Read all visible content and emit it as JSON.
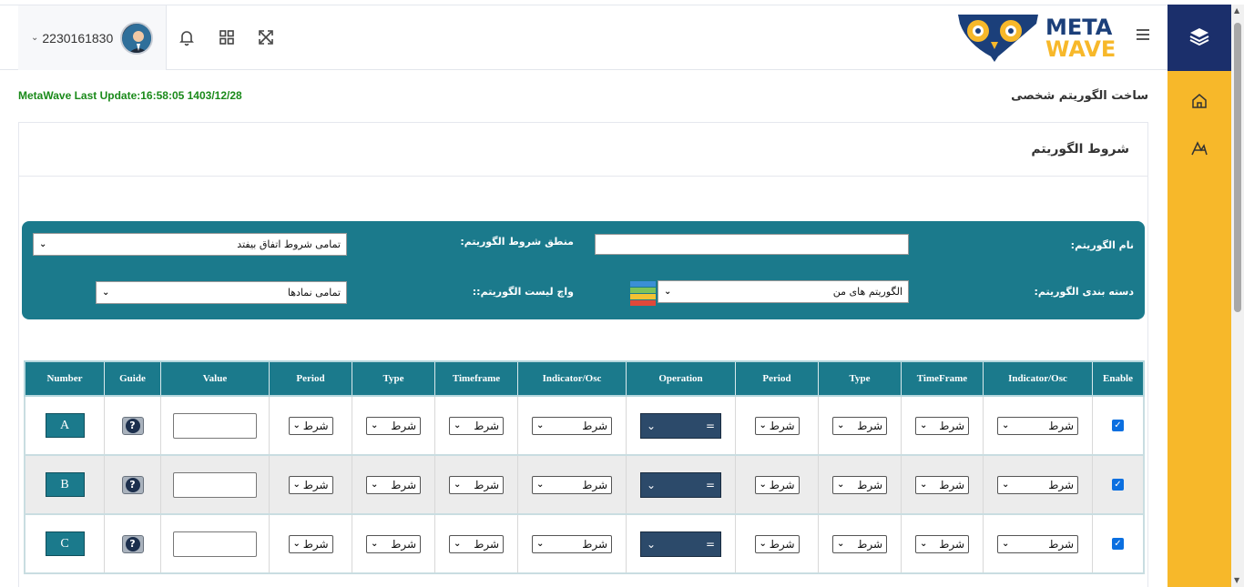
{
  "header": {
    "user_id": "2230161830",
    "logo_top": "META",
    "logo_bottom": "WAVE"
  },
  "page": {
    "last_update": "MetaWave Last Update:16:58:05 1403/12/28",
    "title": "ساخت الگوریتم شخصی",
    "card_title": "شروط الگوریتم"
  },
  "form": {
    "algo_name_label": "نام الگوریتم:",
    "algo_name_value": "",
    "logic_label": "منطق شروط الگوریتم:",
    "logic_value": "تمامی شروط اتفاق بیفتد",
    "category_label": "دسته بندی الگوریتم:",
    "category_value": "الگوریتم های من",
    "watchlist_label": "واچ لیست الگوریتم::",
    "watchlist_value": "تمامی نمادها"
  },
  "table": {
    "headers": [
      "Number",
      "Guide",
      "Value",
      "Period",
      "Type",
      "Timeframe",
      "Indicator/Osc",
      "Operation",
      "Period",
      "Type",
      "TimeFrame",
      "Indicator/Osc",
      "Enable"
    ],
    "condition_placeholder": "شرط",
    "operation_value": "=",
    "guide_symbol": "?",
    "check_symbol": "✓",
    "rows": [
      {
        "number": "A",
        "enabled": true
      },
      {
        "number": "B",
        "enabled": true
      },
      {
        "number": "C",
        "enabled": true
      }
    ]
  },
  "colors": {
    "sidebar_top": "#1b2f6b",
    "sidebar_body": "#f7b82a",
    "teal": "#1b7a8c",
    "update_green": "#1a8a1a"
  },
  "icons": [
    "layers-icon",
    "home-icon",
    "chart-icon",
    "bell-icon",
    "grid-icon",
    "fullscreen-icon",
    "menu-icon",
    "help-icon"
  ]
}
